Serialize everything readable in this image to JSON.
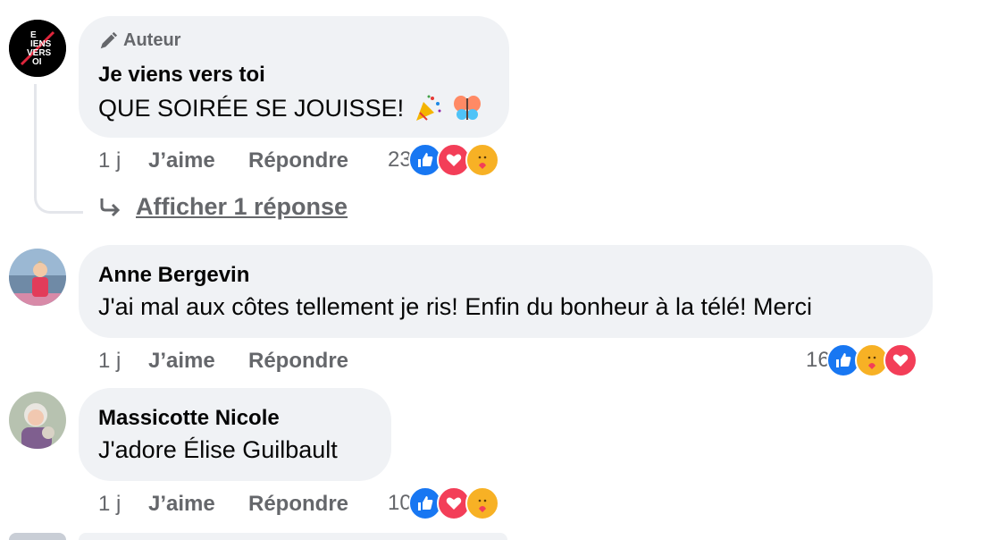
{
  "comments": [
    {
      "author_badge": "Auteur",
      "author": "Je viens vers toi",
      "avatar_text": "JE VIENS VERS TOI",
      "text": "QUE SOIRÉE SE JOUISSE!",
      "time": "1 j",
      "like_label": "J’aime",
      "reply_label": "Répondre",
      "reaction_count": "23",
      "reactions": [
        "like",
        "love",
        "care"
      ]
    },
    {
      "author": "Anne Bergevin",
      "text": "J'ai mal aux côtes tellement je ris! Enfin du bonheur à la télé! Merci",
      "time": "1 j",
      "like_label": "J’aime",
      "reply_label": "Répondre",
      "reaction_count": "16",
      "reactions": [
        "like",
        "care",
        "love"
      ]
    },
    {
      "author": "Massicotte Nicole",
      "text": "J'adore Élise Guilbault",
      "time": "1 j",
      "like_label": "J’aime",
      "reply_label": "Répondre",
      "reaction_count": "10",
      "reactions": [
        "like",
        "love",
        "care"
      ]
    }
  ],
  "show_replies_label": "Afficher 1 réponse",
  "colors": {
    "like": "#1877f2",
    "love": "#f33e58",
    "care": "#f7b125",
    "secondary_text": "#65676b",
    "bubble": "#f0f2f5"
  },
  "icons": [
    "pencil-icon",
    "party-popper-icon",
    "butterfly-icon",
    "reply-arrow-icon",
    "like-icon",
    "love-icon",
    "care-icon"
  ]
}
